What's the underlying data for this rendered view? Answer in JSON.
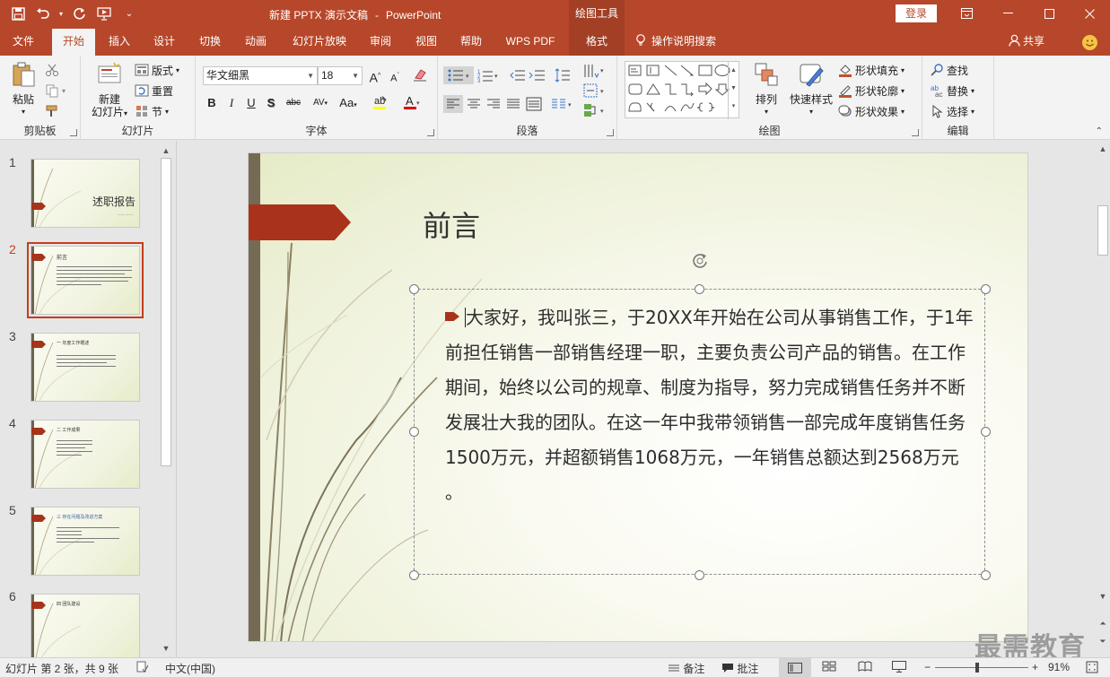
{
  "window": {
    "doc_name": "新建 PPTX 演示文稿",
    "separator": "-",
    "app_name": "PowerPoint",
    "context_group": "绘图工具",
    "login": "登录"
  },
  "tabs": [
    {
      "label": "文件"
    },
    {
      "label": "开始"
    },
    {
      "label": "插入"
    },
    {
      "label": "设计"
    },
    {
      "label": "切换"
    },
    {
      "label": "动画"
    },
    {
      "label": "幻灯片放映"
    },
    {
      "label": "审阅"
    },
    {
      "label": "视图"
    },
    {
      "label": "帮助"
    },
    {
      "label": "WPS PDF"
    },
    {
      "label": "格式"
    }
  ],
  "tell_me": "操作说明搜索",
  "share": "共享",
  "ribbon": {
    "clipboard": {
      "label": "剪贴板",
      "paste": "粘贴"
    },
    "slides": {
      "label": "幻灯片",
      "new_slide_1": "新建",
      "new_slide_2": "幻灯片",
      "layout": "版式",
      "reset": "重置",
      "section": "节"
    },
    "font": {
      "label": "字体",
      "font_name": "华文细黑",
      "font_size": "18",
      "bold": "B",
      "italic": "I",
      "underline": "U",
      "shadow": "S",
      "strike": "abc",
      "spacing": "AV",
      "case": "Aa",
      "grow": "A",
      "shrink": "A"
    },
    "paragraph": {
      "label": "段落"
    },
    "drawing": {
      "label": "绘图",
      "arrange": "排列",
      "quick_styles": "快速样式",
      "shape_fill": "形状填充",
      "shape_outline": "形状轮廓",
      "shape_effects": "形状效果"
    },
    "editing": {
      "label": "编辑",
      "find": "查找",
      "replace": "替换",
      "select": "选择"
    }
  },
  "thumbnails": [
    {
      "num": "1",
      "title": "述职报告"
    },
    {
      "num": "2",
      "title": "前言"
    },
    {
      "num": "3",
      "title": "一 年度工作概述"
    },
    {
      "num": "4",
      "title": "二 工作成果"
    },
    {
      "num": "5",
      "title": "三 存在问题及改进方案"
    },
    {
      "num": "6",
      "title": "四 团队建设"
    }
  ],
  "slide": {
    "title": "前言",
    "body": "大家好，我叫张三，于20XX年开始在公司从事销售工作，于1年前担任销售一部销售经理一职，主要负责公司产品的销售。在工作期间，始终以公司的规章、制度为指导，努力完成销售任务并不断发展壮大我的团队。在这一年中我带领销售一部完成年度销售任务1500万元，并超额销售1068万元，一年销售总额达到2568万元 。"
  },
  "watermark": "最需教育",
  "status": {
    "slide_info": "幻灯片 第 2 张，共 9 张",
    "language": "中文(中国)",
    "notes": "备注",
    "comments": "批注",
    "zoom_minus": "−",
    "zoom_plus": "+",
    "zoom": "91%"
  },
  "colors": {
    "accent": "#b7472a",
    "context_tab": "#a23f24",
    "slide_flag": "#a9331a"
  }
}
